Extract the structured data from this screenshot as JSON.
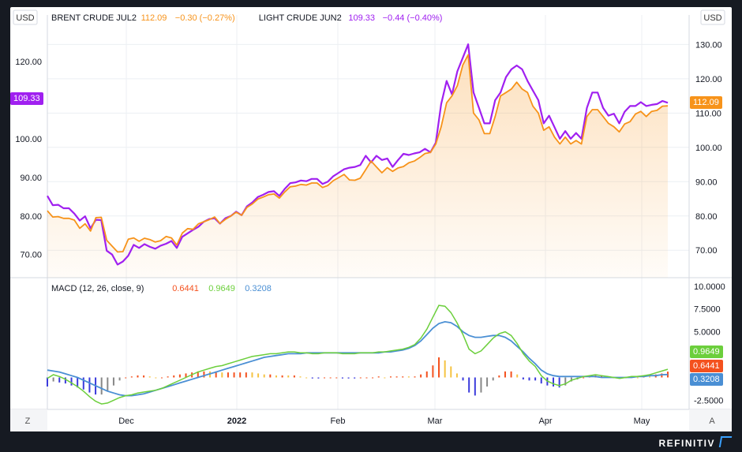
{
  "axis_unit_left": "USD",
  "axis_unit_right": "USD",
  "legend": [
    {
      "name": "BRENT CRUDE JUL2",
      "value": "112.09",
      "change": "−0.30 (−0.27%)",
      "color": "#f7931a"
    },
    {
      "name": "LIGHT CRUDE JUN2",
      "value": "109.33",
      "change": "−0.44 (−0.40%)",
      "color": "#a020f0"
    }
  ],
  "price_tag_left": "109.33",
  "price_tag_right": "112.09",
  "macd": {
    "label": "MACD (12, 26, close, 9)",
    "values": [
      {
        "text": "0.6441",
        "color": "#f4511e"
      },
      {
        "text": "0.9649",
        "color": "#6ccf3c"
      },
      {
        "text": "0.3208",
        "color": "#4a8fd4"
      }
    ],
    "tags": [
      "0.9649",
      "0.6441",
      "0.3208"
    ]
  },
  "corner_left": "Z",
  "corner_right": "A",
  "brand": "REFINITIV",
  "colors": {
    "brent": "#f7931a",
    "light": "#a020f0",
    "macd": "#6ccf3c",
    "signal": "#4a8fd4",
    "hist_pos": "#f4511e",
    "hist_neg": "#3b3bdc"
  },
  "chart_data": {
    "type": "line",
    "x_labels": [
      "Dec",
      "2022",
      "Feb",
      "Mar",
      "Apr",
      "May"
    ],
    "left_axis": {
      "ticks": [
        "70.00",
        "80.00",
        "90.00",
        "100.00",
        "110.00",
        "120.00"
      ],
      "ylim": [
        64,
        128
      ]
    },
    "right_axis": {
      "ticks": [
        "70.00",
        "80.00",
        "90.00",
        "100.00",
        "110.00",
        "120.00",
        "130.00"
      ],
      "ylim": [
        62,
        134
      ]
    },
    "series": [
      {
        "name": "BRENT CRUDE JUL2",
        "axis": "right",
        "values": [
          81.5,
          79.7,
          79.8,
          79.3,
          79.3,
          78.8,
          76.4,
          77.7,
          75.6,
          79.5,
          79.6,
          72.9,
          71.2,
          69.5,
          69.6,
          73.2,
          73.6,
          72.6,
          73.5,
          73.1,
          72.4,
          72.8,
          74.0,
          73.6,
          71.5,
          75.0,
          76.3,
          76.1,
          77.7,
          78.3,
          78.9,
          79.7,
          77.8,
          79.0,
          80.0,
          81.1,
          80.2,
          82.5,
          83.5,
          84.9,
          85.5,
          86.2,
          86.4,
          85.2,
          87.0,
          88.5,
          88.7,
          89.2,
          89.0,
          89.6,
          89.6,
          88.3,
          88.9,
          90.3,
          91.2,
          92.1,
          90.5,
          90.4,
          91.0,
          93.5,
          96.0,
          94.3,
          92.6,
          94.1,
          93.0,
          94.0,
          94.4,
          95.5,
          96.0,
          97.0,
          98.2,
          98.5,
          101.0,
          106.0,
          113.0,
          115.0,
          118.0,
          124.0,
          127.0,
          110.0,
          108.0,
          104.0,
          104.0,
          109.0,
          115.0,
          116.0,
          117.0,
          119.0,
          117.0,
          116.0,
          112.0,
          110.0,
          105.0,
          106.0,
          103.0,
          101.0,
          103.0,
          101.0,
          102.0,
          101.0,
          109.0,
          111.0,
          111.0,
          109.0,
          107.0,
          106.0,
          104.5,
          106.8,
          107.5,
          109.7,
          110.5,
          109.0,
          110.5,
          110.8,
          112.0,
          112.1
        ]
      },
      {
        "name": "LIGHT CRUDE JUN2",
        "axis": "left",
        "values": [
          85.2,
          82.8,
          82.9,
          82.0,
          82.0,
          80.6,
          78.8,
          79.9,
          76.8,
          79.0,
          78.9,
          71.0,
          70.0,
          67.4,
          68.2,
          69.7,
          72.5,
          71.7,
          72.7,
          72.0,
          71.5,
          72.3,
          72.8,
          73.5,
          71.7,
          74.6,
          75.5,
          76.4,
          77.2,
          78.5,
          79.2,
          79.4,
          78.0,
          79.4,
          80.0,
          81.1,
          80.2,
          82.5,
          83.5,
          84.9,
          85.5,
          86.2,
          86.4,
          85.2,
          87.0,
          88.5,
          88.7,
          89.2,
          89.0,
          89.6,
          89.6,
          88.3,
          88.9,
          90.3,
          91.2,
          92.1,
          92.5,
          92.7,
          93.2,
          95.6,
          93.9,
          95.6,
          94.5,
          94.9,
          92.7,
          94.5,
          96.1,
          95.8,
          96.2,
          96.5,
          97.4,
          96.5,
          99.0,
          109.0,
          115.0,
          111.5,
          117.5,
          121.0,
          124.5,
          112.0,
          108.0,
          104.0,
          104.0,
          110.0,
          112.0,
          116.0,
          118.0,
          119.0,
          118.0,
          115.0,
          112.5,
          110.0,
          104.0,
          106.0,
          103.0,
          100.0,
          102.0,
          100.0,
          101.5,
          100.0,
          108.0,
          112.0,
          112.0,
          108.0,
          106.0,
          106.5,
          104.0,
          107.0,
          108.5,
          108.5,
          109.5,
          108.5,
          108.8,
          109.0,
          109.8,
          109.33
        ]
      }
    ],
    "macd_panel": {
      "ticks": [
        "-2.5000",
        "0.0000",
        "2.5000",
        "5.0000",
        "7.5000",
        "10.0000"
      ],
      "ylim": [
        -3.5,
        10.5
      ],
      "macd": [
        -0.1,
        0.3,
        0.1,
        -0.2,
        -0.6,
        -1.0,
        -1.5,
        -2.1,
        -2.6,
        -2.9,
        -2.8,
        -2.5,
        -2.2,
        -2.0,
        -1.9,
        -1.7,
        -1.6,
        -1.5,
        -1.4,
        -1.2,
        -0.9,
        -0.6,
        -0.3,
        0.0,
        0.3,
        0.6,
        0.8,
        1.0,
        1.2,
        1.3,
        1.5,
        1.7,
        1.9,
        2.1,
        2.3,
        2.4,
        2.5,
        2.6,
        2.6,
        2.7,
        2.8,
        2.8,
        2.7,
        2.7,
        2.6,
        2.6,
        2.7,
        2.7,
        2.7,
        2.6,
        2.6,
        2.6,
        2.7,
        2.7,
        2.7,
        2.8,
        2.8,
        2.9,
        3.0,
        3.1,
        3.3,
        3.6,
        4.3,
        5.3,
        6.6,
        7.9,
        7.8,
        7.1,
        6.0,
        4.7,
        3.1,
        2.6,
        2.9,
        3.6,
        4.3,
        4.8,
        5.0,
        4.6,
        3.7,
        2.6,
        1.8,
        1.2,
        0.2,
        -0.4,
        -0.7,
        -0.9,
        -0.7,
        -0.3,
        -0.1,
        0.1,
        0.2,
        0.3,
        0.2,
        0.1,
        0.0,
        -0.1,
        0.0,
        0.1,
        0.1,
        0.2,
        0.3,
        0.5,
        0.7,
        0.9
      ],
      "signal": [
        0.8,
        0.7,
        0.6,
        0.4,
        0.2,
        0.0,
        -0.3,
        -0.6,
        -0.9,
        -1.2,
        -1.5,
        -1.7,
        -1.9,
        -2.0,
        -2.0,
        -1.9,
        -1.8,
        -1.6,
        -1.4,
        -1.2,
        -1.0,
        -0.8,
        -0.6,
        -0.4,
        -0.2,
        0.0,
        0.2,
        0.4,
        0.6,
        0.8,
        1.0,
        1.2,
        1.4,
        1.6,
        1.8,
        2.0,
        2.2,
        2.3,
        2.4,
        2.5,
        2.6,
        2.6,
        2.6,
        2.7,
        2.7,
        2.7,
        2.7,
        2.7,
        2.7,
        2.7,
        2.7,
        2.7,
        2.7,
        2.7,
        2.7,
        2.7,
        2.8,
        2.8,
        2.9,
        3.0,
        3.2,
        3.5,
        4.0,
        4.7,
        5.4,
        5.9,
        6.1,
        6.0,
        5.6,
        5.0,
        4.6,
        4.4,
        4.4,
        4.5,
        4.6,
        4.6,
        4.4,
        4.0,
        3.4,
        2.8,
        2.1,
        1.5,
        0.8,
        0.4,
        0.2,
        0.1,
        0.1,
        0.1,
        0.1,
        0.1,
        0.1,
        0.1,
        0.0,
        0.0,
        0.0,
        0.0,
        0.0,
        0.0,
        0.1,
        0.1,
        0.2,
        0.2,
        0.3,
        0.32
      ]
    }
  }
}
